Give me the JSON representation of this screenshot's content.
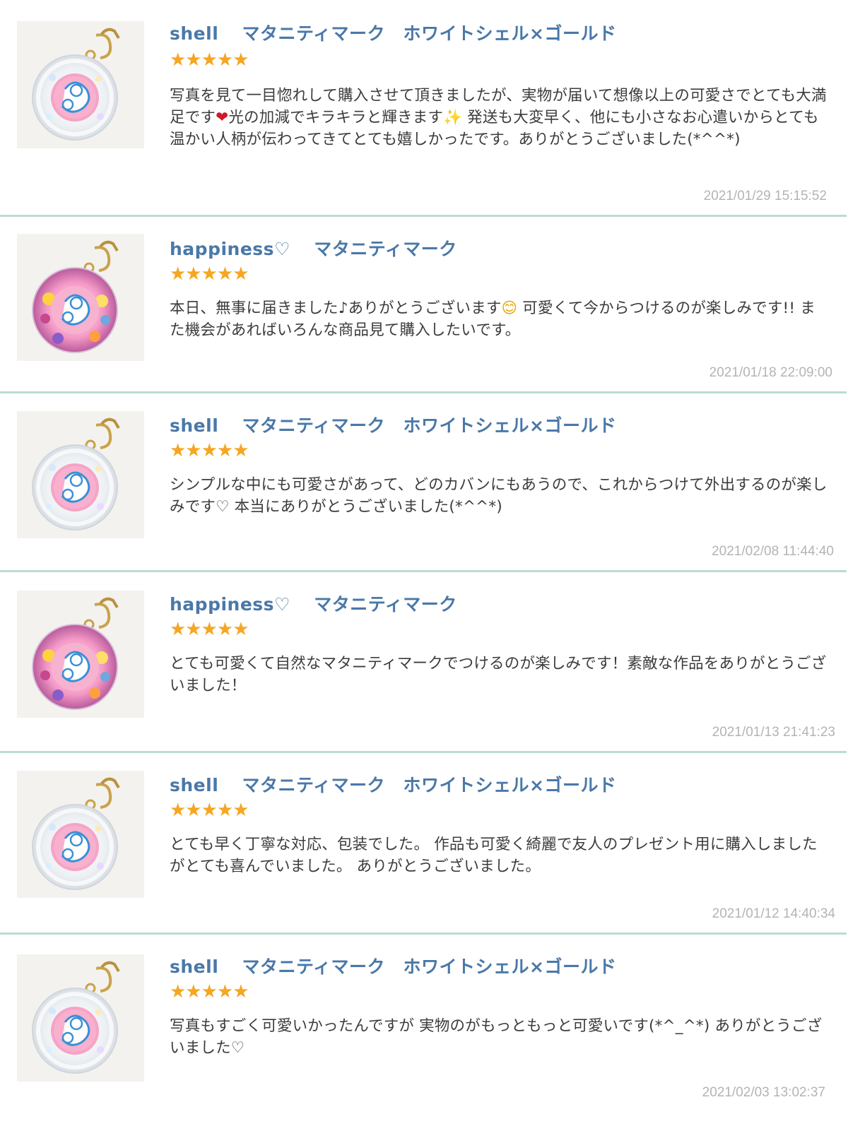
{
  "colors": {
    "username": "#4a78a8",
    "stars": "#f5a623",
    "divider": "#b9dcd4",
    "date": "#b4b4b4",
    "text": "#3c3c3c"
  },
  "reviews": [
    {
      "user": "shell",
      "product": "マタニティマーク　ホワイトシェル×ゴールド",
      "rating": 5,
      "stars": "★★★★★",
      "thumb_variant": "white-shell",
      "comment_parts": [
        "写真を見て一目惚れして購入させて頂きましたが、実物が届いて想像以上の可愛さでとても大満足です",
        "光の加減でキラキラと輝きます",
        " 発送も大変早く、他にも小さなお心遣いからとても温かい人柄が伝わってきてとても嬉しかったです。ありがとうございました(*^^*)"
      ],
      "emojis": [
        "heart-icon",
        "sparkles-icon"
      ],
      "date": "2021/01/29 15:15:52"
    },
    {
      "user": "happiness♡",
      "product": "マタニティマーク",
      "rating": 5,
      "stars": "★★★★★",
      "thumb_variant": "flowers",
      "comment_parts": [
        "本日、無事に届きました♪ありがとうございます",
        " 可愛くて今からつけるのが楽しみです!! また機会があればいろんな商品見て購入したいです。"
      ],
      "emojis": [
        "smile-icon"
      ],
      "date": "2021/01/18 22:09:00"
    },
    {
      "user": "shell",
      "product": "マタニティマーク　ホワイトシェル×ゴールド",
      "rating": 5,
      "stars": "★★★★★",
      "thumb_variant": "white-shell",
      "comment": "シンプルな中にも可愛さがあって、どのカバンにもあうので、これからつけて外出するのが楽しみです♡ 本当にありがとうございました(*^^*)",
      "date": "2021/02/08 11:44:40"
    },
    {
      "user": "happiness♡",
      "product": "マタニティマーク",
      "rating": 5,
      "stars": "★★★★★",
      "thumb_variant": "flowers",
      "comment": "とても可愛くて自然なマタニティマークでつけるのが楽しみです！素敵な作品をありがとうございました！",
      "date": "2021/01/13 21:41:23"
    },
    {
      "user": "shell",
      "product": "マタニティマーク　ホワイトシェル×ゴールド",
      "rating": 5,
      "stars": "★★★★★",
      "thumb_variant": "white-shell",
      "comment": "とても早く丁寧な対応、包装でした。 作品も可愛く綺麗で友人のプレゼント用に購入しましたがとても喜んでいました。 ありがとうございました。",
      "date": "2021/01/12 14:40:34"
    },
    {
      "user": "shell",
      "product": "マタニティマーク　ホワイトシェル×ゴールド",
      "rating": 5,
      "stars": "★★★★★",
      "thumb_variant": "white-shell",
      "comment": "写真もすごく可愛いかったんですが 実物のがもっともっと可愛いです(*^_^*) ありがとうございました♡",
      "date": "2021/02/03 13:02:37"
    }
  ]
}
